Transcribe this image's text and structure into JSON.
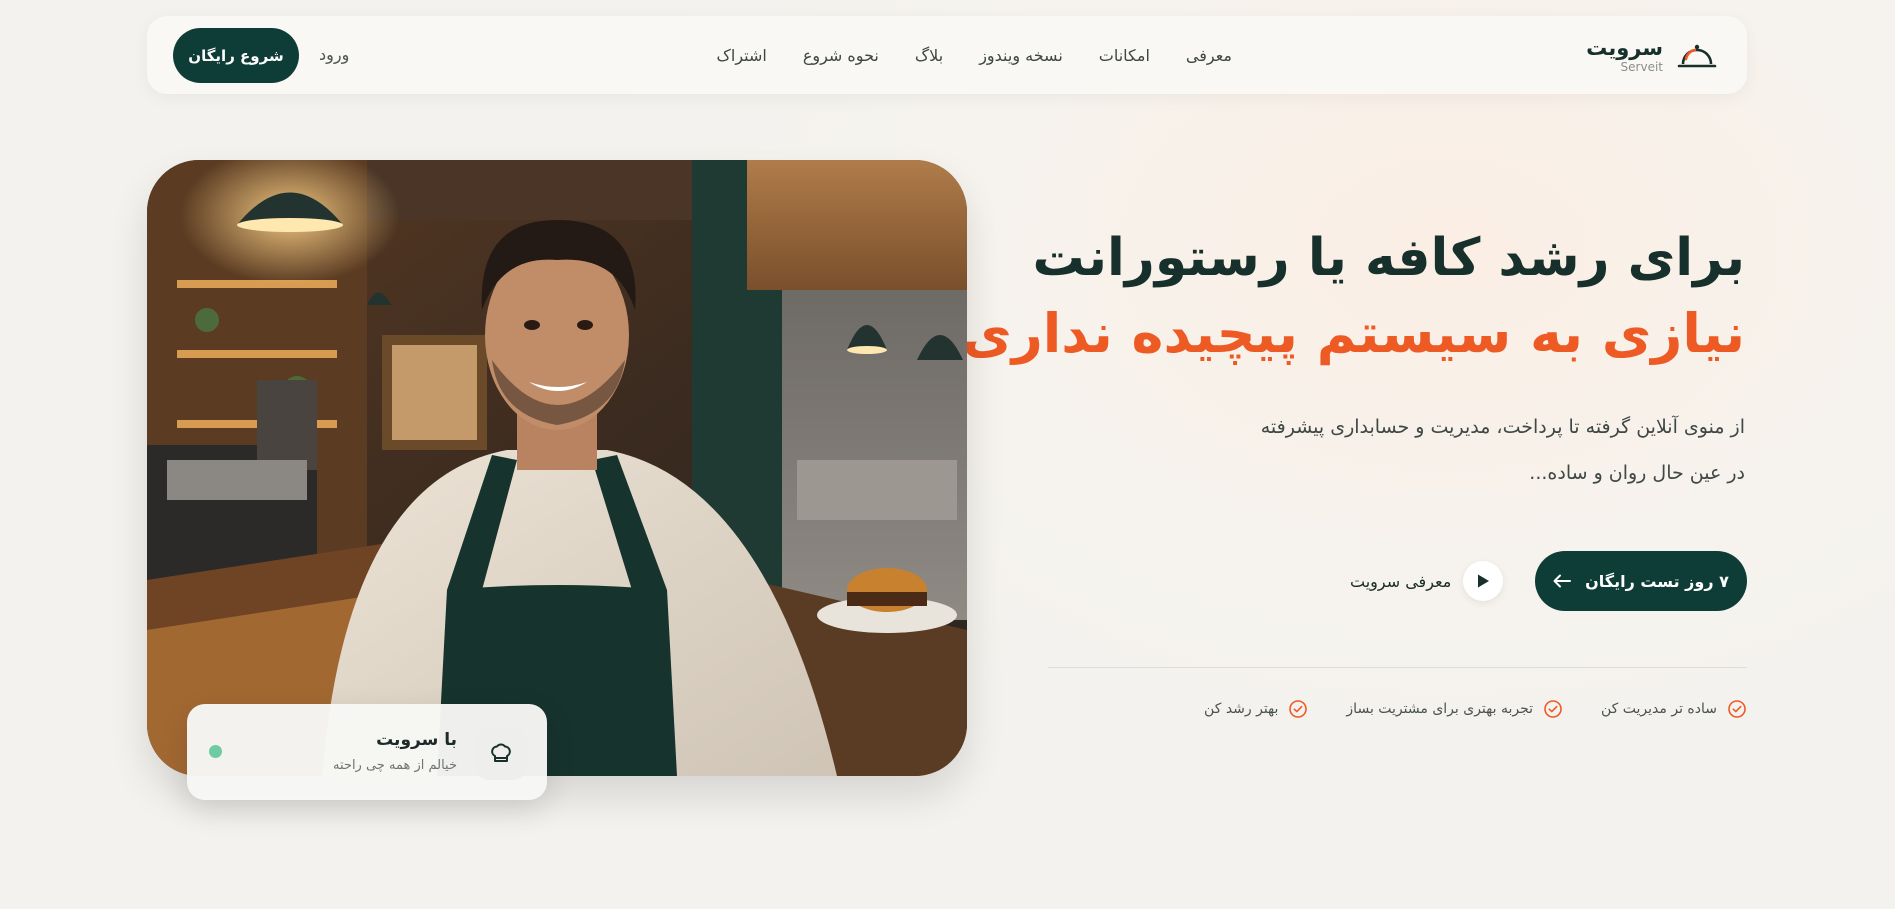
{
  "header": {
    "brand_name": "سرویت",
    "brand_latin": "Serveit",
    "nav": [
      {
        "label": "معرفی"
      },
      {
        "label": "امکانات"
      },
      {
        "label": "نسخه ویندوز"
      },
      {
        "label": "بلاگ"
      },
      {
        "label": "نحوه شروع"
      },
      {
        "label": "اشتراک"
      }
    ],
    "login_label": "ورود",
    "start_label": "شروع رایگان"
  },
  "hero": {
    "title_line1": "برای رشد کافه یا رستورانت",
    "title_line2": "نیازی به سیستم پیچیده نداری!",
    "desc_line1": "از منوی آنلاین گرفته تا پرداخت، مدیریت و حسابداری پیشرفته",
    "desc_line2": "در عین حال روان و ساده...",
    "cta_primary": "۷ روز تست رایگان",
    "cta_video": "معرفی سرویت",
    "features": [
      {
        "label": "ساده تر مدیریت کن"
      },
      {
        "label": "تجربه بهتری برای مشتریت بساز"
      },
      {
        "label": "بهتر رشد کن"
      }
    ],
    "accent_color": "#ee5a24",
    "primary_color": "#0e3d37"
  },
  "badge": {
    "title": "با سرویت",
    "subtitle": "خیالم از همه چی راحته",
    "status_color": "#6fcba3"
  },
  "icons": {
    "brand": "serving-cloche-icon",
    "arrow": "arrow-left-icon",
    "play": "play-icon",
    "check": "check-circle-icon",
    "chef": "chef-hat-icon"
  }
}
